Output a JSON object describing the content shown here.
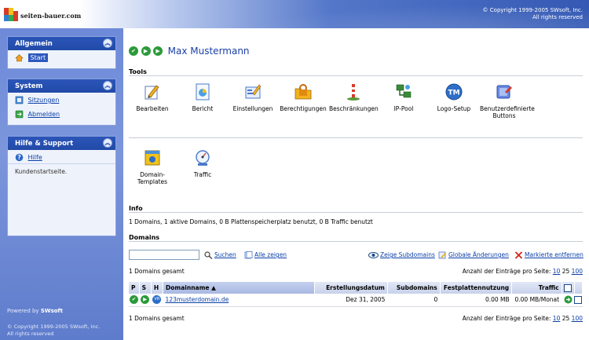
{
  "header": {
    "logo_text": "seiten-bauer.com",
    "copyright_line1": "© Copyright 1999-2005 SWsoft, Inc.",
    "copyright_line2": "All rights reserved"
  },
  "sidebar": {
    "panels": [
      {
        "title": "Allgemein",
        "items": [
          {
            "label": "Start",
            "icon": "home-icon"
          }
        ]
      },
      {
        "title": "System",
        "items": [
          {
            "label": "Sitzungen",
            "icon": "sessions-icon"
          },
          {
            "label": "Abmelden",
            "icon": "logout-icon"
          }
        ]
      },
      {
        "title": "Hilfe & Support",
        "items": [
          {
            "label": "Hilfe",
            "icon": "help-icon"
          }
        ],
        "description": "Kundenstartseite."
      }
    ],
    "powered_by_label": "Powered by",
    "powered_by_brand": "SWsoft",
    "copyright_line1": "© Copyright 1999-2005 SWsoft, Inc.",
    "copyright_line2": "All rights reserved"
  },
  "main": {
    "user_name": "Max Mustermann",
    "tools_heading": "Tools",
    "tools": [
      {
        "label": "Bearbeiten",
        "icon": "edit-icon"
      },
      {
        "label": "Bericht",
        "icon": "report-icon"
      },
      {
        "label": "Einstellungen",
        "icon": "settings-icon"
      },
      {
        "label": "Berechtigungen",
        "icon": "permissions-icon"
      },
      {
        "label": "Beschränkungen",
        "icon": "limits-icon"
      },
      {
        "label": "IP-Pool",
        "icon": "ip-pool-icon"
      },
      {
        "label": "Logo-Setup",
        "icon": "logo-setup-icon"
      },
      {
        "label": "Benutzerdefinierte Buttons",
        "icon": "custom-buttons-icon"
      },
      {
        "label": "Domain-Templates",
        "icon": "domain-templates-icon"
      },
      {
        "label": "Traffic",
        "icon": "traffic-icon"
      }
    ],
    "info_heading": "Info",
    "info_text": "1 Domains, 1 aktive Domains, 0 B Plattenspeicherplatz benutzt, 0 B Traffic benutzt",
    "domains_heading": "Domains",
    "search": {
      "value": "",
      "button_label": "Suchen",
      "show_all_label": "Alle zeigen"
    },
    "actions": {
      "show_subdomains": "Zeige Subdomains",
      "global_changes": "Globale Änderungen",
      "remove_selected": "Markierte entfernen"
    },
    "total_label": "1 Domains gesamt",
    "per_page_label": "Anzahl der Einträge pro Seite:",
    "per_page_options": [
      "10",
      "25",
      "100"
    ],
    "table": {
      "headers": [
        "P",
        "S",
        "H",
        "Domainname ▲",
        "Erstellungsdatum",
        "Subdomains",
        "Festplattennutzung",
        "Traffic"
      ],
      "rows": [
        {
          "domain": "123musterdomain.de",
          "created": "Dez 31, 2005",
          "subdomains": "0",
          "disk": "0.00 MB",
          "traffic": "0.00 MB/Monat"
        }
      ]
    }
  }
}
